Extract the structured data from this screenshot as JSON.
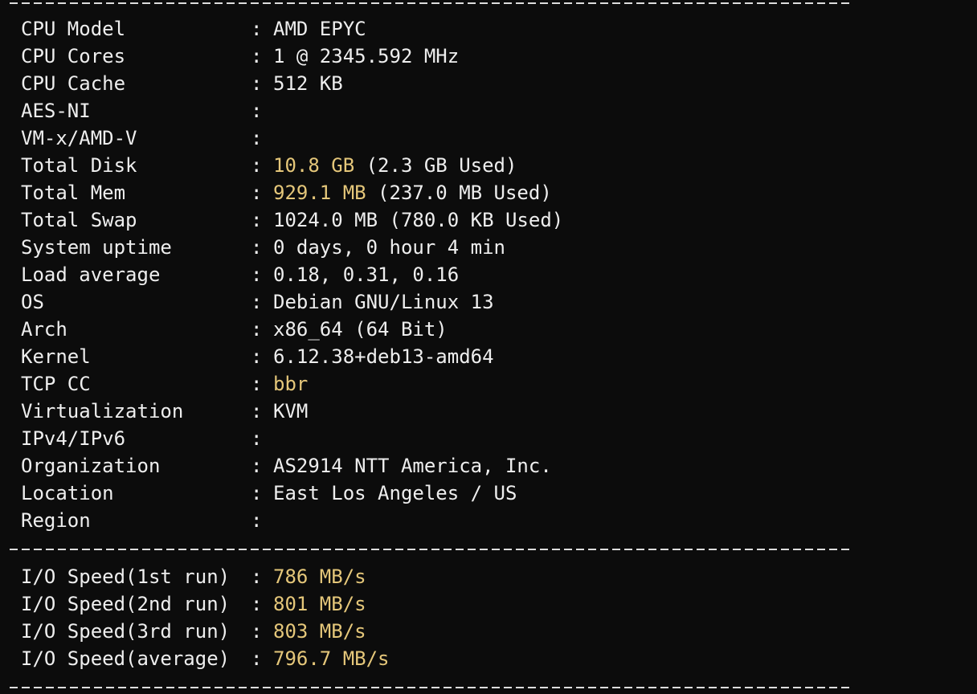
{
  "colors": {
    "background": "#0c0c0c",
    "text": "#eeeeee",
    "highlight": "#e5c77a"
  },
  "separator": ":",
  "system": [
    {
      "label": "CPU Model",
      "value": "AMD EPYC",
      "extra": ""
    },
    {
      "label": "CPU Cores",
      "value": "1 @ 2345.592 MHz",
      "extra": ""
    },
    {
      "label": "CPU Cache",
      "value": "512 KB",
      "extra": ""
    },
    {
      "label": "AES-NI",
      "value": "",
      "extra": ""
    },
    {
      "label": "VM-x/AMD-V",
      "value": "",
      "extra": ""
    },
    {
      "label": "Total Disk",
      "value": "10.8 GB",
      "extra": " (2.3 GB Used)"
    },
    {
      "label": "Total Mem",
      "value": "929.1 MB",
      "extra": " (237.0 MB Used)"
    },
    {
      "label": "Total Swap",
      "value": "1024.0 MB (780.0 KB Used)",
      "extra": ""
    },
    {
      "label": "System uptime",
      "value": "0 days, 0 hour 4 min",
      "extra": ""
    },
    {
      "label": "Load average",
      "value": "0.18, 0.31, 0.16",
      "extra": ""
    },
    {
      "label": "OS",
      "value": "Debian GNU/Linux 13",
      "extra": ""
    },
    {
      "label": "Arch",
      "value": "x86_64 (64 Bit)",
      "extra": ""
    },
    {
      "label": "Kernel",
      "value": "6.12.38+deb13-amd64",
      "extra": ""
    },
    {
      "label": "TCP CC",
      "value": "bbr",
      "extra": ""
    },
    {
      "label": "Virtualization",
      "value": "KVM",
      "extra": ""
    },
    {
      "label": "IPv4/IPv6",
      "value": "",
      "extra": ""
    },
    {
      "label": "Organization",
      "value": "AS2914 NTT America, Inc.",
      "extra": ""
    },
    {
      "label": "Location",
      "value": "East Los Angeles / US",
      "extra": ""
    },
    {
      "label": "Region",
      "value": "",
      "extra": ""
    }
  ],
  "io": [
    {
      "label": "I/O Speed(1st run)",
      "value": "786 MB/s"
    },
    {
      "label": "I/O Speed(2nd run)",
      "value": "801 MB/s"
    },
    {
      "label": "I/O Speed(3rd run)",
      "value": "803 MB/s"
    },
    {
      "label": "I/O Speed(average)",
      "value": "796.7 MB/s"
    }
  ]
}
